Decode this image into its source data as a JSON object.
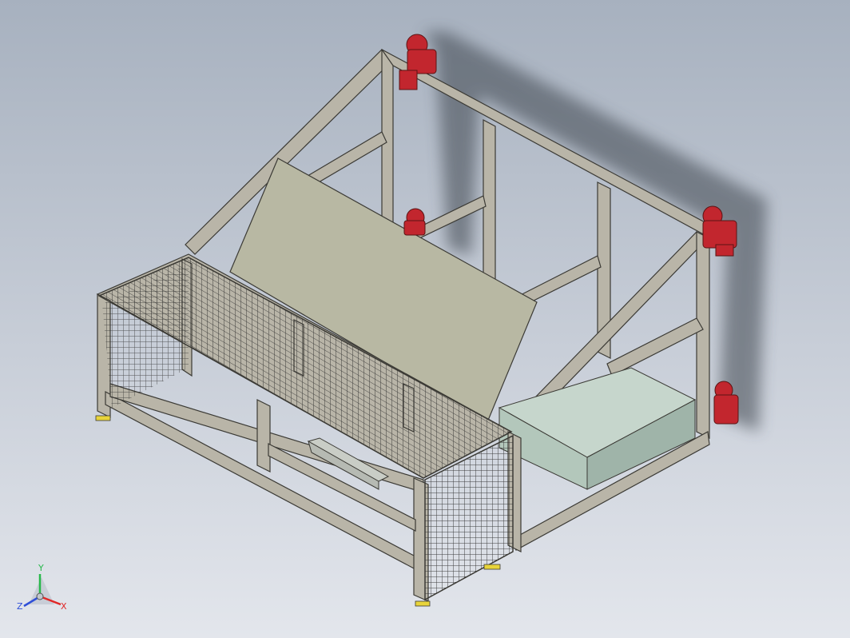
{
  "viewport": {
    "background_top": "#a7b1bf",
    "background_bottom": "#e3e6ec"
  },
  "colors": {
    "frame_fill": "#b9b5a8",
    "frame_stroke": "#3b3a35",
    "frame_dark": "#8f8b80",
    "panel_fill": "#b8b8a3",
    "box_fill": "#b3c7bb",
    "box_side": "#9fb4a9",
    "tray_fill": "#b6bab3",
    "caster_red": "#c2262e",
    "foot_yellow": "#e8d43a",
    "mesh": "#2b2b2b",
    "shadow": "#3e454d"
  },
  "icons": {
    "casters": "wheel-caster-icon",
    "triad": "coordinate-triad-icon"
  },
  "triad": {
    "y_label": "Y",
    "x_label": "X",
    "z_label": "Z",
    "y_color": "#27b84b",
    "x_color": "#e02828",
    "z_color": "#2f4fd8"
  }
}
